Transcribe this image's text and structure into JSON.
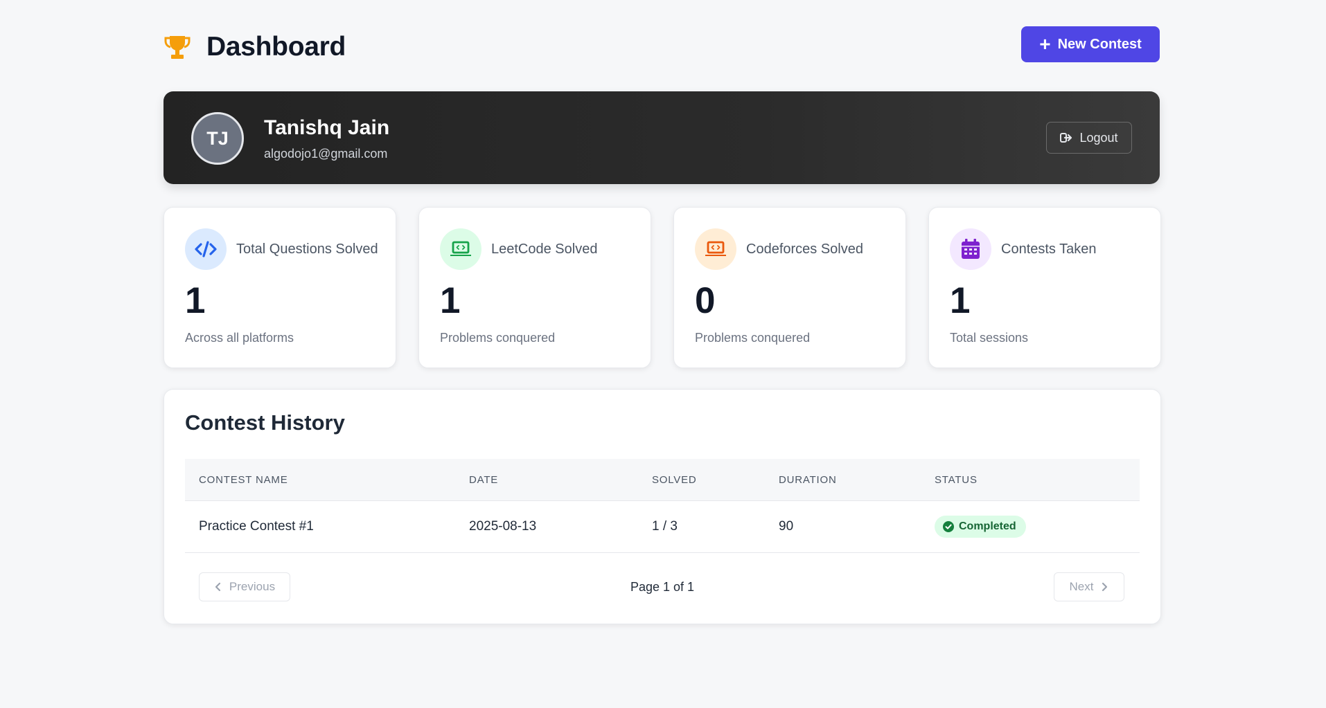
{
  "header": {
    "title": "Dashboard",
    "new_contest_label": "New Contest",
    "icon": "trophy-icon"
  },
  "profile": {
    "initials": "TJ",
    "name": "Tanishq Jain",
    "email": "algodojo1@gmail.com",
    "logout_label": "Logout"
  },
  "stats": [
    {
      "label": "Total Questions Solved",
      "value": "1",
      "sub": "Across all platforms",
      "icon": "code-icon",
      "color": "#2563eb",
      "bg": "#dbeafe"
    },
    {
      "label": "LeetCode Solved",
      "value": "1",
      "sub": "Problems conquered",
      "icon": "laptop-code-icon",
      "color": "#16a34a",
      "bg": "#dcfce7"
    },
    {
      "label": "Codeforces Solved",
      "value": "0",
      "sub": "Problems conquered",
      "icon": "laptop-code-icon",
      "color": "#ea580c",
      "bg": "#ffedd5"
    },
    {
      "label": "Contests Taken",
      "value": "1",
      "sub": "Total sessions",
      "icon": "calendar-icon",
      "color": "#7e22ce",
      "bg": "#f3e8ff"
    }
  ],
  "history": {
    "title": "Contest History",
    "columns": [
      "CONTEST NAME",
      "DATE",
      "SOLVED",
      "DURATION",
      "STATUS"
    ],
    "rows": [
      {
        "name": "Practice Contest #1",
        "date": "2025-08-13",
        "solved": "1 / 3",
        "duration": "90",
        "status": "Completed"
      }
    ],
    "pagination": {
      "previous_label": "Previous",
      "next_label": "Next",
      "page_text": "Page 1 of 1"
    }
  },
  "colors": {
    "accent": "#4f46e5",
    "status_completed": "#166534"
  }
}
